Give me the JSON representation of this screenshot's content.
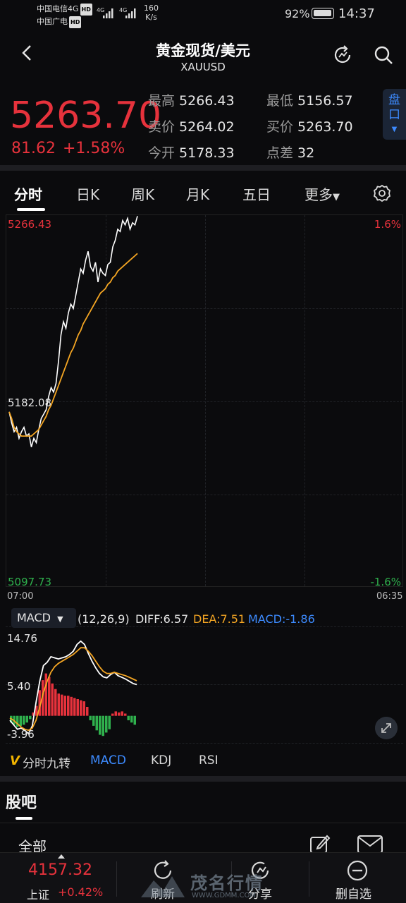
{
  "status_bar": {
    "carrier1": "中国电信4G",
    "carrier2": "中国广电",
    "hd": "HD",
    "network1": "4G",
    "network2": "4G",
    "speed_value": "160",
    "speed_unit": "K/s",
    "battery": "92%",
    "time": "14:37"
  },
  "header": {
    "title": "黄金现货/美元",
    "symbol": "XAUUSD"
  },
  "quote": {
    "price": "5263.70",
    "change": "81.62",
    "change_pct": "+1.58%",
    "high_label": "最高",
    "high": "5266.43",
    "low_label": "最低",
    "low": "5156.57",
    "sell_label": "卖价",
    "sell": "5264.02",
    "buy_label": "买价",
    "buy": "5263.70",
    "open_label": "今开",
    "open": "5178.33",
    "spread_label": "点差",
    "spread": "32",
    "pankou": "盘口"
  },
  "tabs": [
    "分时",
    "日K",
    "周K",
    "月K",
    "五日",
    "更多"
  ],
  "chart_data": [
    {
      "type": "line",
      "y_top_label": "5266.43",
      "y_mid_label": "5182.08",
      "y_bottom_label": "5097.73",
      "pct_top_label": "1.6%",
      "pct_bottom_label": "-1.6%",
      "x_start_label": "07:00",
      "x_end_label": "06:35",
      "ylim": [
        5097.73,
        5266.43
      ],
      "series": [
        {
          "color": "#ffffff",
          "values": [
            5177,
            5172,
            5168,
            5170,
            5165,
            5168,
            5170,
            5166,
            5167,
            5161,
            5165,
            5163,
            5169,
            5174,
            5176,
            5178,
            5184,
            5188,
            5186,
            5190,
            5200,
            5212,
            5218,
            5215,
            5222,
            5226,
            5224,
            5230,
            5236,
            5242,
            5240,
            5246,
            5250,
            5243,
            5241,
            5245,
            5236,
            5242,
            5240,
            5239,
            5244,
            5245,
            5252,
            5255,
            5260,
            5259,
            5264,
            5262,
            5265,
            5260,
            5263,
            5262,
            5266
          ]
        },
        {
          "color": "#f5a623",
          "values": [
            5177,
            5174,
            5170,
            5168,
            5167,
            5166,
            5166,
            5166,
            5166,
            5166,
            5167,
            5168,
            5169,
            5171,
            5173,
            5175,
            5178,
            5180,
            5183,
            5186,
            5189,
            5192,
            5195,
            5198,
            5201,
            5204,
            5206,
            5209,
            5212,
            5214,
            5217,
            5219,
            5221,
            5223,
            5225,
            5227,
            5229,
            5231,
            5232,
            5233,
            5235,
            5236,
            5238,
            5239,
            5241,
            5242,
            5243,
            5244,
            5245,
            5246,
            5247,
            5248,
            5249
          ]
        }
      ]
    },
    {
      "type": "bar",
      "y_top_label": "14.76",
      "y_mid_label": "5.40",
      "y_bottom_label": "-3.96",
      "ylim": [
        -3.96,
        14.76
      ],
      "params": "(12,26,9)",
      "diff_label": "DIFF:6.57",
      "dea_label": "DEA:7.51",
      "macd_label": "MACD:-1.86",
      "histogram": [
        -1.2,
        -1.6,
        -2.0,
        -1.8,
        -1.6,
        -1.2,
        -0.6,
        0.6,
        1.8,
        4.6,
        6.4,
        7.6,
        7.0,
        5.8,
        4.8,
        4.0,
        3.8,
        3.6,
        3.6,
        3.4,
        3.2,
        3.0,
        2.8,
        2.6,
        1.6,
        -0.8,
        -1.8,
        -2.6,
        -3.4,
        -3.6,
        -3.0,
        -2.4,
        0.4,
        0.8,
        0.6,
        0.8,
        0.4,
        -0.8,
        -1.2,
        -1.6
      ],
      "diff": [
        -0.8,
        -1.6,
        -2.4,
        -2.2,
        -2.6,
        -3.2,
        -1.8,
        2.4,
        6.2,
        9.0,
        9.6,
        10.6,
        10.4,
        10.2,
        10.4,
        10.6,
        11.0,
        11.6,
        12.8,
        13.4,
        12.8,
        11.2,
        9.8,
        8.6,
        7.6,
        7.0,
        6.8,
        7.4,
        7.8,
        7.2,
        6.9,
        6.6,
        6.2,
        5.8,
        5.6
      ],
      "dea": [
        -0.4,
        -0.8,
        -1.4,
        -2.0,
        -2.4,
        -2.6,
        -2.2,
        -0.8,
        1.6,
        4.2,
        6.2,
        7.8,
        8.8,
        9.4,
        9.8,
        10.2,
        10.6,
        11.0,
        11.6,
        12.2,
        12.2,
        11.6,
        10.8,
        9.8,
        8.8,
        8.0,
        7.6,
        7.6,
        7.8,
        7.6,
        7.4,
        7.2,
        6.9,
        6.6,
        6.3
      ]
    }
  ],
  "macd_select": "MACD",
  "indicator_tabs": {
    "jiuzhuan": "分时九转",
    "macd": "MACD",
    "kdj": "KDJ",
    "rsi": "RSI"
  },
  "guba": {
    "title": "股吧",
    "all": "全部"
  },
  "bottom_bar": {
    "index_value": "4157.32",
    "index_name": "上证",
    "index_pct": "+0.42%",
    "refresh": "刷新",
    "share": "分享",
    "remove_watch": "删自选"
  },
  "watermark": {
    "text": "茂名行情",
    "url": "WWW.GDMM.COM"
  },
  "colors": {
    "up": "#e6323c",
    "down": "#2fb14d",
    "accent": "#3d8bff",
    "avg_line": "#f5a623"
  }
}
